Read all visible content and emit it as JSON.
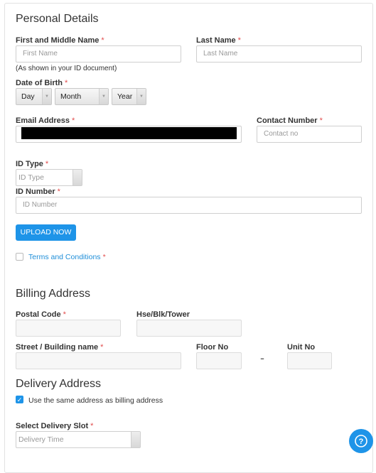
{
  "personal": {
    "title": "Personal Details",
    "first_name_label": "First and Middle Name",
    "first_name_placeholder": "First Name",
    "last_name_label": "Last Name",
    "last_name_placeholder": "Last Name",
    "id_note": "(As shown in your ID document)",
    "dob_label": "Date of Birth",
    "day": "Day",
    "month": "Month",
    "year": "Year",
    "email_label": "Email Address",
    "contact_label": "Contact Number",
    "contact_placeholder": "Contact no",
    "id_type_label": "ID Type",
    "id_type_value": "ID Type",
    "id_number_label": "ID Number",
    "id_number_placeholder": "ID Number",
    "upload_label": "UPLOAD NOW",
    "terms_label": "Terms and Conditions",
    "required_mark": "*"
  },
  "billing": {
    "title": "Billing Address",
    "postal_code_label": "Postal Code",
    "hse_label": "Hse/Blk/Tower",
    "street_label": "Street / Building name",
    "floor_label": "Floor No",
    "unit_label": "Unit No",
    "dash": "-"
  },
  "delivery": {
    "title": "Delivery Address",
    "same_address_label": "Use the same address as billing address",
    "same_address_checked": true,
    "slot_label": "Select Delivery Slot",
    "slot_value": "Delivery Time"
  },
  "help": {
    "icon": "question-icon"
  },
  "colors": {
    "accent": "#1e94e8",
    "required": "#e24b4b"
  }
}
